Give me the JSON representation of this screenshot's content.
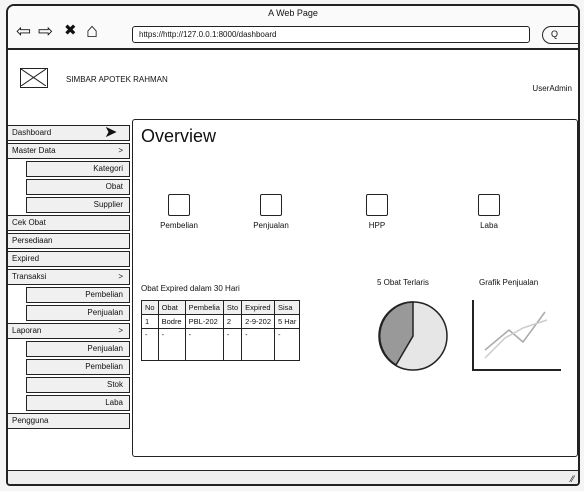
{
  "browser": {
    "title": "A Web Page",
    "url": "https://http://127.0.0.1:8000/dashboard",
    "search_glyph": "Q"
  },
  "icons": {
    "back": "⇦",
    "forward": "⇨",
    "close": "✖",
    "home": "⌂",
    "cursor": "➤",
    "resize": "⁄⁄"
  },
  "header": {
    "brand": "SIMBAR APOTEK RAHMAN",
    "user": "UserAdmin"
  },
  "sidebar": {
    "items": [
      {
        "label": "Dashboard"
      },
      {
        "label": "Master Data",
        "arrow": ">"
      },
      {
        "label": "Kategori"
      },
      {
        "label": "Obat"
      },
      {
        "label": "Supplier"
      },
      {
        "label": "Cek Obat"
      },
      {
        "label": "Persediaan"
      },
      {
        "label": "Expired"
      },
      {
        "label": "Transaksi",
        "arrow": ">"
      },
      {
        "label": "Pembelian"
      },
      {
        "label": "Penjualan"
      },
      {
        "label": "Laporan",
        "arrow": ">"
      },
      {
        "label": "Penjualan"
      },
      {
        "label": "Pembelian"
      },
      {
        "label": "Stok"
      },
      {
        "label": "Laba"
      },
      {
        "label": "Pengguna"
      }
    ]
  },
  "main": {
    "title": "Overview",
    "cards": [
      "Pembelian",
      "Penjualan",
      "HPP",
      "Laba"
    ],
    "expired_title": "Obat Expired dalam 30 Hari",
    "top5_title": "5 Obat Terlaris",
    "sales_chart_title": "Grafik Penjualan",
    "table": {
      "headers": [
        "No",
        "Obat",
        "Pembelia",
        "Sto",
        "Expired",
        "Sisa"
      ],
      "row1": [
        "1",
        "Bodre",
        "PBL-202",
        "2",
        "2-9-202",
        "5 Har"
      ],
      "row2": [
        "-",
        "-",
        "-",
        "-",
        "-",
        "-"
      ]
    }
  }
}
